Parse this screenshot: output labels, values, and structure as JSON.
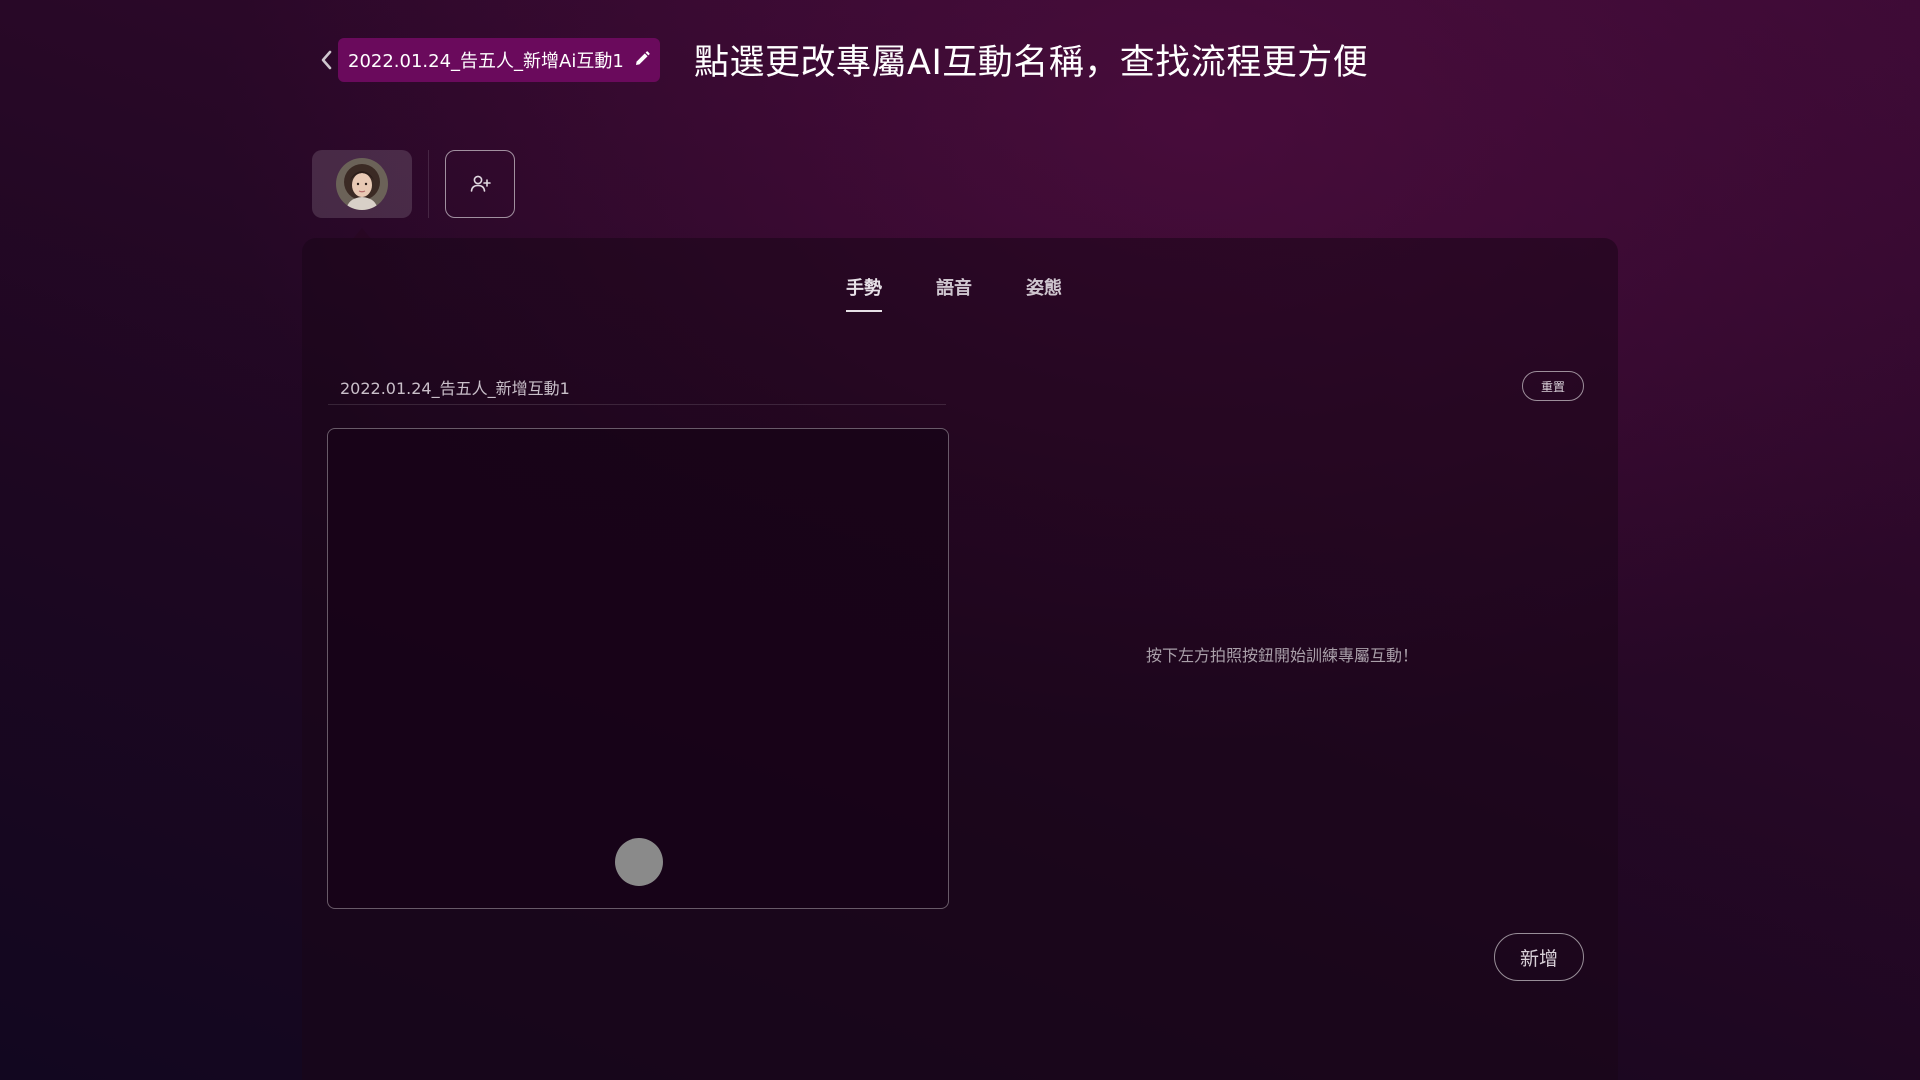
{
  "header": {
    "interaction_name": "2022.01.24_告五人_新增Ai互動1",
    "hint_title": "點選更改專屬AI互動名稱，查找流程更方便",
    "icons": {
      "back": "chevron-left-icon",
      "edit": "pencil-icon"
    }
  },
  "characters": {
    "avatar": "avatar",
    "add_member_icon": "user-plus-icon"
  },
  "tabs": [
    {
      "label": "手勢",
      "active": true
    },
    {
      "label": "語音",
      "active": false
    },
    {
      "label": "姿態",
      "active": false
    }
  ],
  "editor": {
    "record_name": "2022.01.24_告五人_新增互動1",
    "reset_label": "重置",
    "empty_hint": "按下左方拍照按鈕開始訓練專屬互動！",
    "add_label": "新增",
    "shutter_icon": "shutter-button"
  },
  "colors": {
    "chip_background": "#6a0a5c",
    "page_background_top": "#3a0a34",
    "page_background_bottom": "#120720",
    "shutter": "#8a8a8a"
  }
}
